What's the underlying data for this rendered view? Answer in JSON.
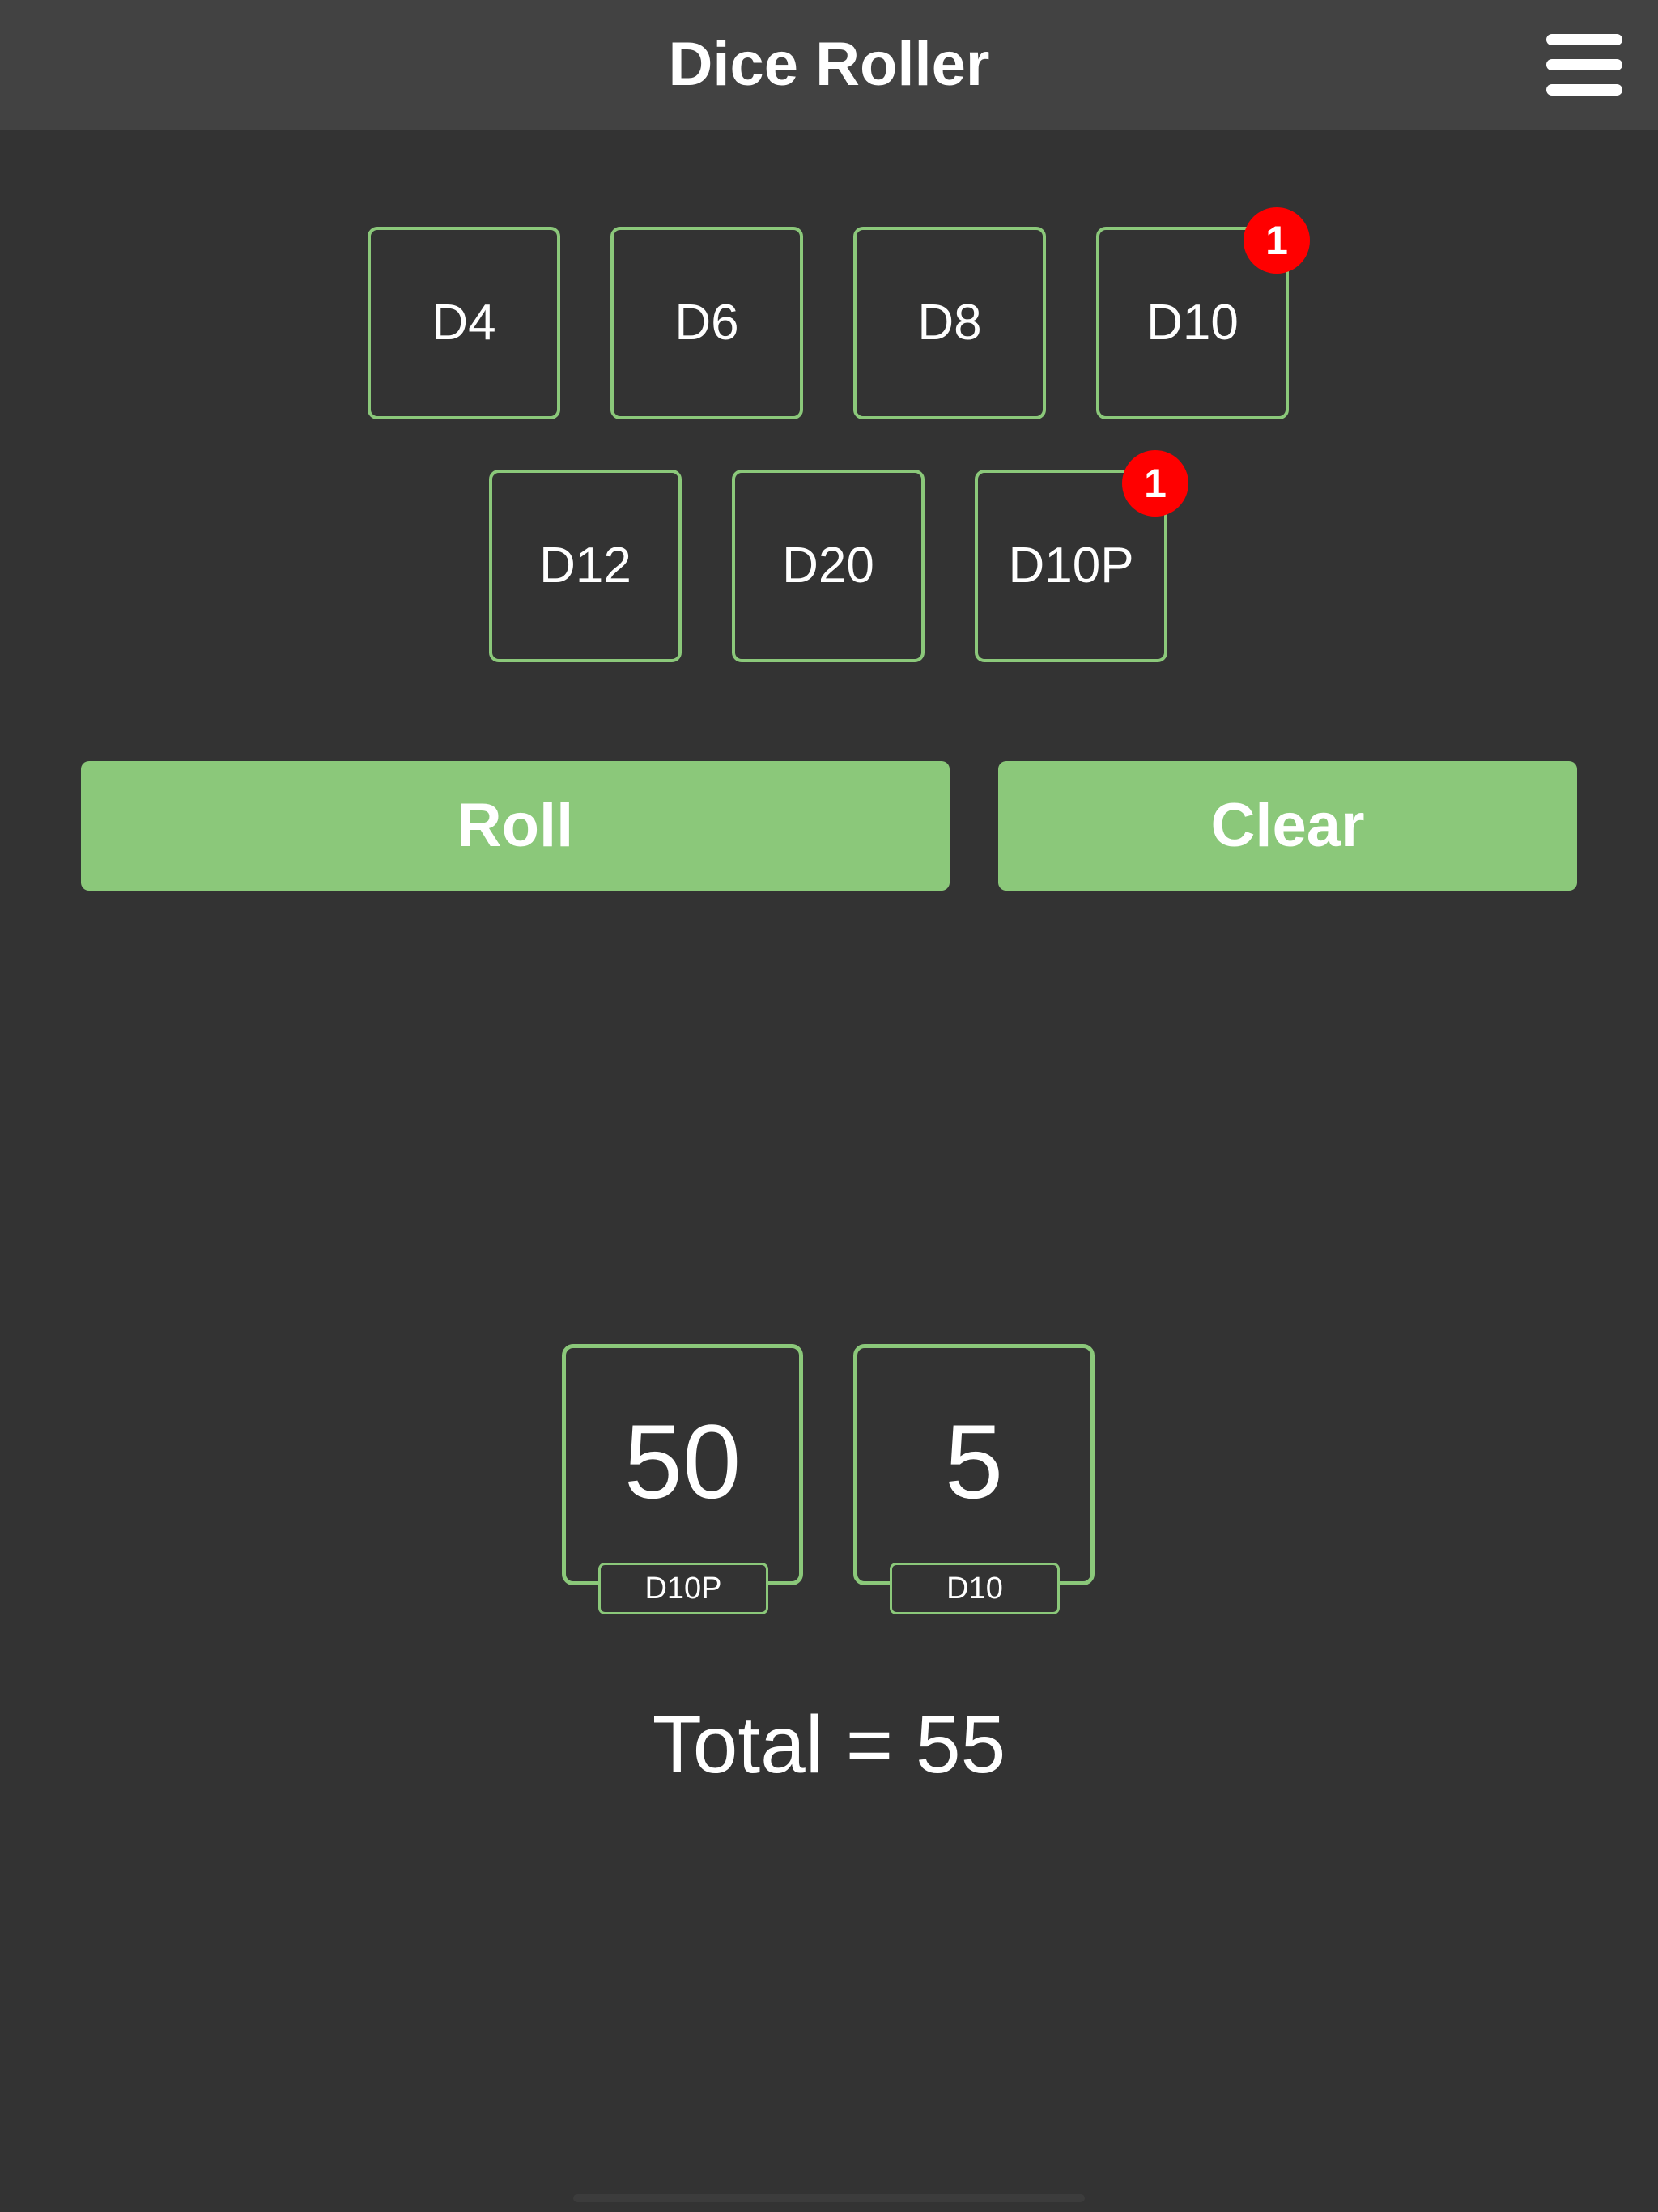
{
  "header": {
    "title": "Dice Roller",
    "menu_icon": "hamburger-menu-icon"
  },
  "dice": [
    {
      "label": "D4"
    },
    {
      "label": "D6"
    },
    {
      "label": "D8"
    },
    {
      "label": "D10",
      "count": "1"
    },
    {
      "label": "D12"
    },
    {
      "label": "D20"
    },
    {
      "label": "D10P",
      "count": "1"
    }
  ],
  "actions": {
    "roll_label": "Roll",
    "clear_label": "Clear"
  },
  "results": [
    {
      "value": "50",
      "die": "D10P"
    },
    {
      "value": "5",
      "die": "D10"
    }
  ],
  "total_text": "Total = 55",
  "colors": {
    "accent": "#8bc87a",
    "background": "#333333",
    "header": "#424242",
    "badge": "#ff0000"
  }
}
